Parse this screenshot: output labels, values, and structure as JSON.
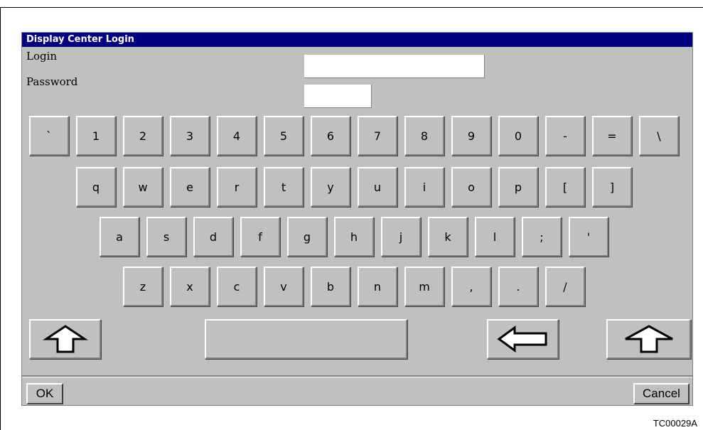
{
  "dialog": {
    "title": "Display Center Login"
  },
  "fields": {
    "login_label": "Login",
    "login_value": "",
    "password_label": "Password",
    "password_value": ""
  },
  "keyboard": {
    "row1": [
      "`",
      "1",
      "2",
      "3",
      "4",
      "5",
      "6",
      "7",
      "8",
      "9",
      "0",
      "-",
      "=",
      "\\"
    ],
    "row2": [
      "q",
      "w",
      "e",
      "r",
      "t",
      "y",
      "u",
      "i",
      "o",
      "p",
      "[",
      "]"
    ],
    "row3": [
      "a",
      "s",
      "d",
      "f",
      "g",
      "h",
      "j",
      "k",
      "l",
      ";",
      "'"
    ],
    "row4": [
      "z",
      "x",
      "c",
      "v",
      "b",
      "n",
      "m",
      ",",
      ".",
      "/"
    ],
    "special_icons": {
      "shift_left": "shift-up-arrow-icon",
      "space": "space-bar",
      "backspace": "backspace-left-arrow-icon",
      "shift_right": "shift-up-arrow-icon"
    }
  },
  "buttons": {
    "ok": "OK",
    "cancel": "Cancel"
  },
  "figure_caption": "TC00029A"
}
